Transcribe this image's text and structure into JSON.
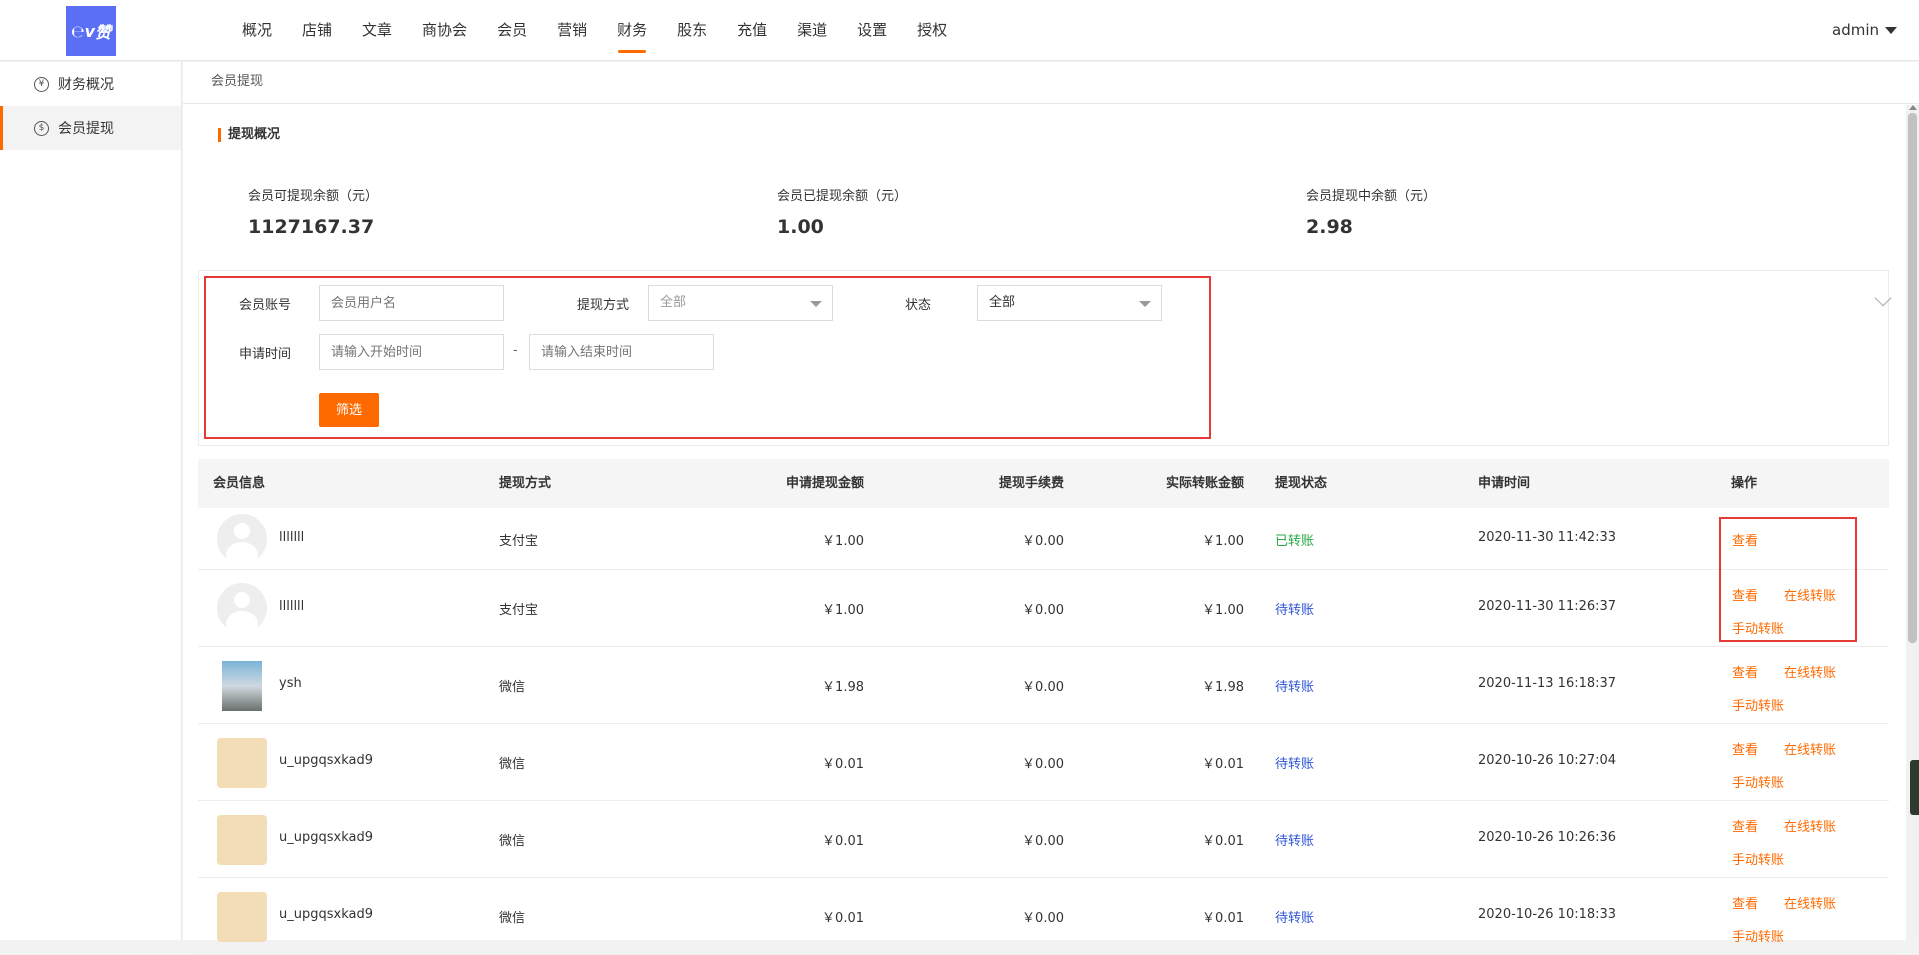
{
  "header": {
    "logo_text": "赞",
    "nav": [
      "概况",
      "店铺",
      "文章",
      "商协会",
      "会员",
      "营销",
      "财务",
      "股东",
      "充值",
      "渠道",
      "设置",
      "授权"
    ],
    "active_nav": "财务",
    "user": "admin"
  },
  "sidebar": {
    "items": [
      {
        "label": "财务概况",
        "icon": "yen-circle-icon"
      },
      {
        "label": "会员提现",
        "icon": "withdraw-circle-icon"
      }
    ],
    "active": "会员提现"
  },
  "breadcrumb": "会员提现",
  "overview": {
    "title": "提现概况",
    "stats": [
      {
        "label": "会员可提现余额（元）",
        "value": "1127167.37"
      },
      {
        "label": "会员已提现余额（元）",
        "value": "1.00"
      },
      {
        "label": "会员提现中余额（元）",
        "value": "2.98"
      }
    ]
  },
  "filter": {
    "account_label": "会员账号",
    "account_placeholder": "会员用户名",
    "method_label": "提现方式",
    "method_value": "全部",
    "status_label": "状态",
    "status_value": "全部",
    "time_label": "申请时间",
    "start_placeholder": "请输入开始时间",
    "range_separator": "-",
    "end_placeholder": "请输入结束时间",
    "submit_label": "筛选"
  },
  "table": {
    "columns": [
      "会员信息",
      "提现方式",
      "申请提现金额",
      "提现手续费",
      "实际转账金额",
      "提现状态",
      "申请时间",
      "操作"
    ],
    "rows": [
      {
        "avatar": "default",
        "name": "lllllll",
        "method": "支付宝",
        "amount": "￥1.00",
        "fee": "￥0.00",
        "actual": "￥1.00",
        "status": "已转账",
        "status_type": "done",
        "time": "2020-11-30 11:42:33",
        "ops": [
          "查看"
        ]
      },
      {
        "avatar": "default",
        "name": "lllllll",
        "method": "支付宝",
        "amount": "￥1.00",
        "fee": "￥0.00",
        "actual": "￥1.00",
        "status": "待转账",
        "status_type": "pending",
        "time": "2020-11-30 11:26:37",
        "ops": [
          "查看",
          "在线转账",
          "手动转账"
        ]
      },
      {
        "avatar": "photo",
        "name": "ysh",
        "method": "微信",
        "amount": "￥1.98",
        "fee": "￥0.00",
        "actual": "￥1.98",
        "status": "待转账",
        "status_type": "pending",
        "time": "2020-11-13 16:18:37",
        "ops": [
          "查看",
          "在线转账",
          "手动转账"
        ]
      },
      {
        "avatar": "cartoon",
        "name": "u_upgqsxkad9",
        "method": "微信",
        "amount": "￥0.01",
        "fee": "￥0.00",
        "actual": "￥0.01",
        "status": "待转账",
        "status_type": "pending",
        "time": "2020-10-26 10:27:04",
        "ops": [
          "查看",
          "在线转账",
          "手动转账"
        ]
      },
      {
        "avatar": "cartoon",
        "name": "u_upgqsxkad9",
        "method": "微信",
        "amount": "￥0.01",
        "fee": "￥0.00",
        "actual": "￥0.01",
        "status": "待转账",
        "status_type": "pending",
        "time": "2020-10-26 10:26:36",
        "ops": [
          "查看",
          "在线转账",
          "手动转账"
        ]
      },
      {
        "avatar": "cartoon",
        "name": "u_upgqsxkad9",
        "method": "微信",
        "amount": "￥0.01",
        "fee": "￥0.00",
        "actual": "￥0.01",
        "status": "待转账",
        "status_type": "pending",
        "time": "2020-10-26 10:18:33",
        "ops": [
          "查看",
          "在线转账",
          "手动转账"
        ]
      }
    ]
  },
  "colors": {
    "accent": "#ff6a00",
    "highlight_box": "#e53935",
    "status_done": "#28a745",
    "status_pending": "#2f55d4"
  }
}
